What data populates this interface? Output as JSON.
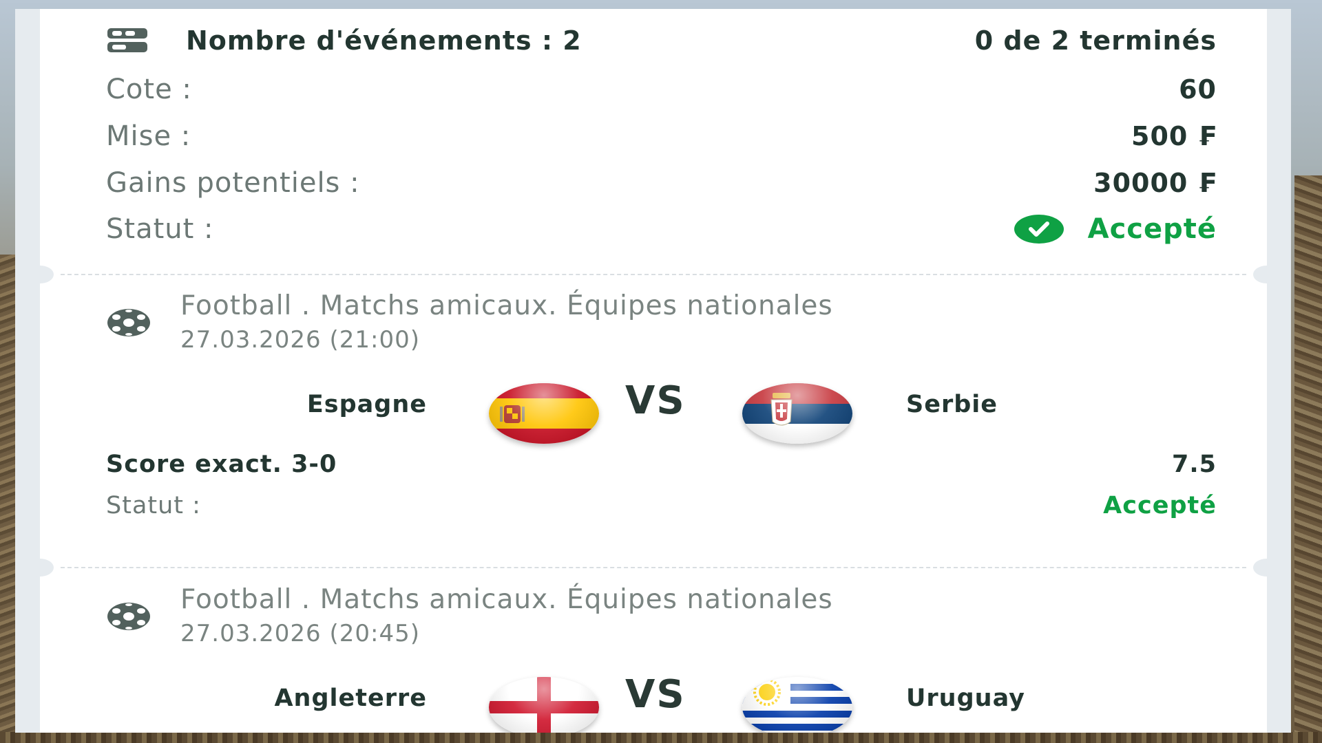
{
  "summary": {
    "events_label": "Nombre d'événements : 2",
    "progress_label": "0 de 2 terminés",
    "odds_label": "Cote :",
    "odds_value": "60",
    "stake_label": "Mise :",
    "stake_value": "500 ₣",
    "gains_label": "Gains potentiels :",
    "gains_value": "30000 ₣",
    "status_label": "Statut :",
    "status_value": "Accepté"
  },
  "events": [
    {
      "sport_league": "Football . Matchs amicaux. Équipes nationales",
      "datetime": "27.03.2026 (21:00)",
      "home": "Espagne",
      "away": "Serbie",
      "vs": "VS",
      "bet": "Score exact. 3-0",
      "odds": "7.5",
      "status_label": "Statut :",
      "status_value": "Accepté"
    },
    {
      "sport_league": "Football . Matchs amicaux. Équipes nationales",
      "datetime": "27.03.2026 (20:45)",
      "home": "Angleterre",
      "away": "Uruguay",
      "vs": "VS"
    }
  ],
  "colors": {
    "accent_green": "#0fa144",
    "text_dark": "#233631",
    "text_muted": "#6c7875"
  },
  "icons": {
    "header": "ticket-list-icon",
    "sport": "soccer-ball-icon",
    "status": "check-circle-icon"
  }
}
